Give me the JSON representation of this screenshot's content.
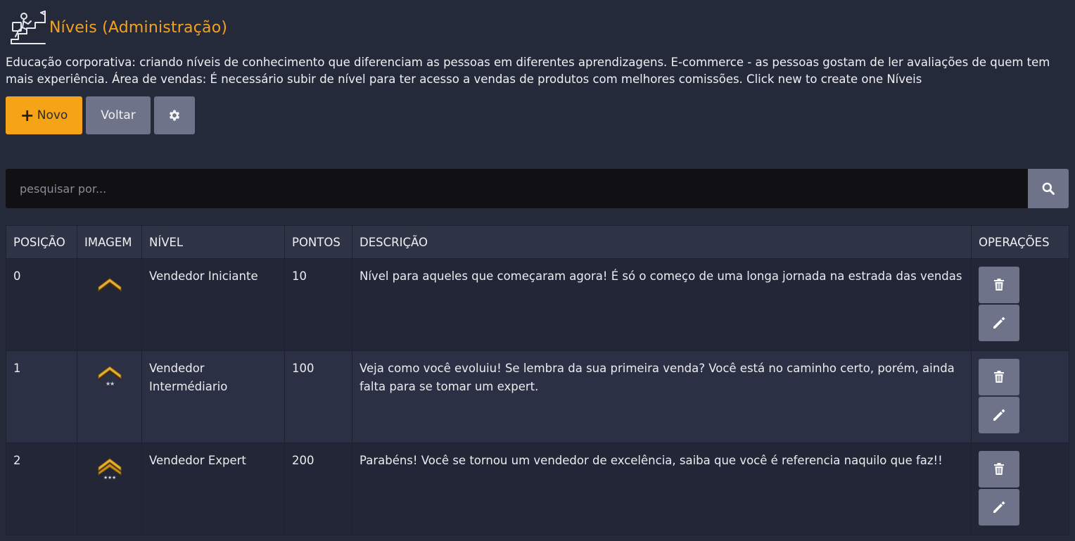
{
  "header": {
    "title": "Níveis (Administração)",
    "icon": "person-climbing-steps-to-flag-icon"
  },
  "description": "Educação corporativa: criando níveis de conhecimento que diferenciam as pessoas em diferentes aprendizagens. E-commerce - as pessoas gostam de ler avaliações de quem tem mais experiência. Área de vendas: É necessário subir de nível para ter acesso a vendas de produtos com melhores comissões. Click new to create one Níveis",
  "toolbar": {
    "new_label": "Novo",
    "back_label": "Voltar",
    "config_icon": "gear-icon"
  },
  "search": {
    "placeholder": "pesquisar por...",
    "icon": "search-icon"
  },
  "table": {
    "headers": {
      "position": "POSIÇÃO",
      "image": "IMAGEM",
      "level": "NÍVEL",
      "points": "PONTOS",
      "description": "DESCRIÇÃO",
      "operations": "OPERAÇÕES"
    },
    "rows": [
      {
        "position": "0",
        "image": "chevron-rank-0-stars-icon",
        "level": "Vendedor Iniciante",
        "points": "10",
        "description": "Nível para aqueles que começaram agora! É só o começo de uma longa jornada na estrada das vendas"
      },
      {
        "position": "1",
        "image": "chevron-rank-2-stars-icon",
        "level": "Vendedor Intermédiario",
        "points": "100",
        "description": "Veja como você evoluiu! Se lembra da sua primeira venda? Você está no caminho certo, porém, ainda falta para se tomar um expert."
      },
      {
        "position": "2",
        "image": "chevron-rank-3-stars-icon",
        "level": "Vendedor Expert",
        "points": "200",
        "description": "Parabéns! Você se tornou um vendedor de excelência, saiba que você é referencia naquilo que faz!!"
      }
    ]
  },
  "colors": {
    "background": "#252a3b",
    "accent": "#f5a417",
    "title": "#f2a21d",
    "button_gray": "#6e7389",
    "search_bg": "#111113"
  }
}
